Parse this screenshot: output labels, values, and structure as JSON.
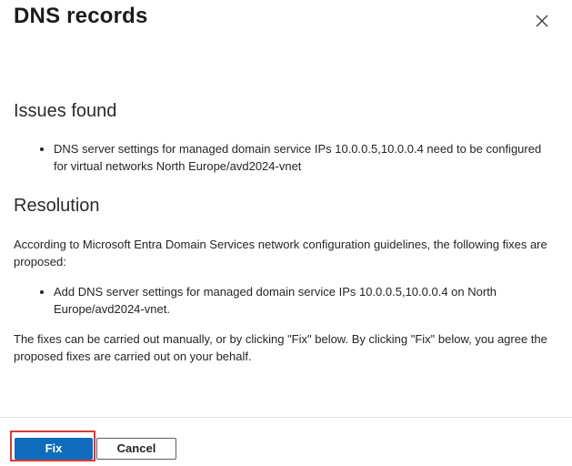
{
  "dialog": {
    "title": "DNS records"
  },
  "issues": {
    "heading": "Issues found",
    "items": [
      "DNS server settings for managed domain service IPs 10.0.0.5,10.0.0.4 need to be configured for virtual networks North Europe/avd2024-vnet"
    ]
  },
  "resolution": {
    "heading": "Resolution",
    "intro": "According to Microsoft Entra Domain Services network configuration guidelines, the following fixes are proposed:",
    "items": [
      "Add DNS server settings for managed domain service IPs 10.0.0.5,10.0.0.4 on North Europe/avd2024-vnet."
    ],
    "note": "The fixes can be carried out manually, or by clicking \"Fix\" below. By clicking \"Fix\" below, you agree the proposed fixes are carried out on your behalf."
  },
  "footer": {
    "fix_label": "Fix",
    "cancel_label": "Cancel"
  },
  "colors": {
    "primary": "#0f6cbd",
    "highlight": "#d93a3a"
  }
}
